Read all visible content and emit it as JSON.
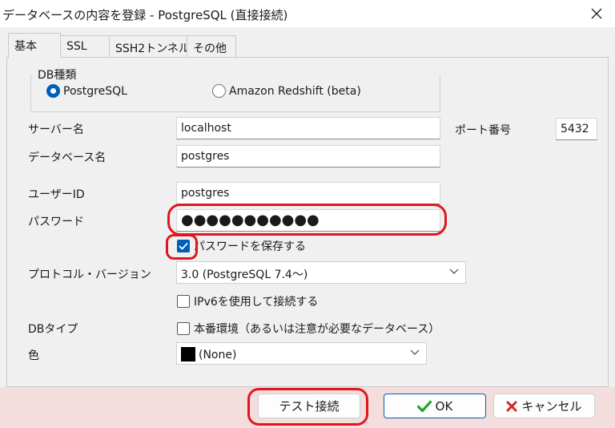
{
  "window": {
    "title": "データベースの内容を登録 - PostgreSQL (直接接続)",
    "close_icon": "close-icon"
  },
  "tabs": [
    {
      "label": "基本",
      "active": true
    },
    {
      "label": "SSL",
      "active": false
    },
    {
      "label": "SSH2トンネル",
      "active": false
    },
    {
      "label": "その他",
      "active": false
    }
  ],
  "db_type_group": {
    "title": "DB種類",
    "options": [
      {
        "label": "PostgreSQL",
        "selected": true
      },
      {
        "label": "Amazon Redshift (beta)",
        "selected": false
      }
    ]
  },
  "form": {
    "server_label": "サーバー名",
    "server_value": "localhost",
    "port_label": "ポート番号",
    "port_value": "5432",
    "database_label": "データベース名",
    "database_value": "postgres",
    "user_label": "ユーザーID",
    "user_value": "postgres",
    "password_label": "パスワード",
    "password_value": "●●●●●●●●●●●",
    "save_password_label": "パスワードを保存する",
    "save_password_checked": true,
    "protocol_label": "プロトコル・バージョン",
    "protocol_value": "3.0  (PostgreSQL 7.4～)",
    "ipv6_label": "IPv6を使用して接続する",
    "ipv6_checked": false,
    "dbtype_label": "DBタイプ",
    "production_label": "本番環境（あるいは注意が必要なデータベース）",
    "production_checked": false,
    "color_label": "色",
    "color_value": "(None)",
    "color_swatch": "#000000"
  },
  "buttons": {
    "test": "テスト接続",
    "ok": "OK",
    "cancel": "キャンセル"
  },
  "colors": {
    "accent": "#005fb8",
    "annotation": "#e0161f",
    "ok_check": "#22a52f",
    "cancel_x": "#d6262b"
  }
}
